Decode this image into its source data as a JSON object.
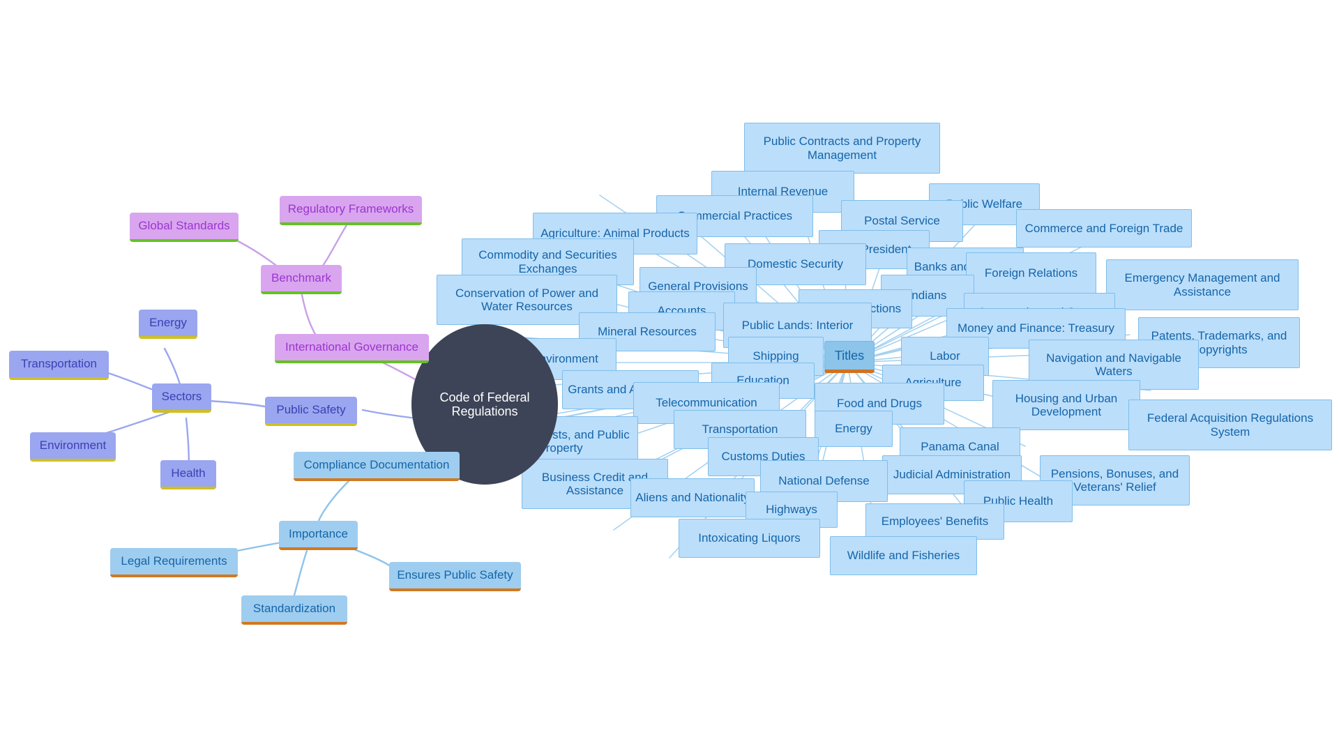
{
  "diagram": {
    "type": "mind-map",
    "root": {
      "label": "Code of Federal Regulations",
      "shape": "ellipse",
      "fill": "#3d4457",
      "text_color": "#ffffff"
    },
    "palette": {
      "title_fill": "#bbdefb",
      "title_stroke": "#7fbde9",
      "title_text": "#1565a8",
      "hub_fill": "#8cc4ea",
      "hub_underline": "#d2711e",
      "importance_fill": "#9ecdf0",
      "importance_underline": "#d2781f",
      "importance_text": "#1565a8",
      "sector_fill": "#9aa6ef",
      "sector_underline": "#cfc01f",
      "sector_text": "#3b3fb5",
      "governance_fill": "#d9a5ef",
      "governance_underline": "#63c224",
      "governance_text": "#9b35cf",
      "background": "#ffffff"
    },
    "branches": [
      {
        "name": "sectors",
        "hub": "Sectors",
        "children": [
          "Transportation",
          "Energy",
          "Environment",
          "Health"
        ]
      },
      {
        "name": "public-safety",
        "hub": "Public Safety",
        "children": []
      },
      {
        "name": "governance",
        "hub": "Benchmark",
        "children": [
          "Global Standards",
          "Regulatory Frameworks",
          "International Governance"
        ]
      },
      {
        "name": "importance",
        "hub": "Importance",
        "children": [
          "Legal Requirements",
          "Standardization",
          "Ensures Public Safety"
        ]
      },
      {
        "name": "compliance",
        "hub": "Compliance Documentation",
        "children": []
      },
      {
        "name": "titles",
        "hub": "Titles",
        "children": []
      }
    ],
    "nodes": {
      "root": "Code of Federal Regulations",
      "sectors": {
        "hub": "Sectors",
        "transportation": "Transportation",
        "energy": "Energy",
        "environment": "Environment",
        "health": "Health"
      },
      "public_safety": "Public Safety",
      "governance": {
        "benchmark": "Benchmark",
        "global_standards": "Global Standards",
        "regulatory_frameworks": "Regulatory Frameworks",
        "international_governance": "International Governance"
      },
      "importance": {
        "hub": "Importance",
        "legal_requirements": "Legal Requirements",
        "standardization": "Standardization",
        "ensures_public_safety": "Ensures Public Safety"
      },
      "compliance_documentation": "Compliance Documentation",
      "titles_hub": "Titles"
    },
    "titles": [
      "Public Contracts and Property Management",
      "Internal Revenue",
      "Public Welfare",
      "Commercial Practices",
      "Postal Service",
      "Commerce and Foreign Trade",
      "Agriculture: Animal Products",
      "The President",
      "Commodity and Securities Exchanges",
      "Domestic Security",
      "Banks and Banking",
      "Foreign Relations",
      "Emergency Management and Assistance",
      "Conservation of Power and Water Resources",
      "General Provisions",
      "Indians",
      "Accounts",
      "Federal Elections",
      "Aeronautics and Space",
      "Mineral Resources",
      "Public Lands: Interior",
      "Money and Finance: Treasury",
      "Patents, Trademarks, and Copyrights",
      "Protection of Environment",
      "Shipping",
      "Labor",
      "Navigation and Navigable Waters",
      "Education",
      "Agriculture",
      "Grants and Agreements",
      "Telecommunication",
      "Food and Drugs",
      "Housing and Urban Development",
      "Parks, Forests, and Public Property",
      "Transportation",
      "Energy",
      "Federal Acquisition Regulations System",
      "Panama Canal",
      "Business Credit and Assistance",
      "Customs Duties",
      "Judicial Administration",
      "Pensions, Bonuses, and Veterans' Relief",
      "Aliens and Nationality",
      "National Defense",
      "Public Health",
      "Highways",
      "Employees' Benefits",
      "Intoxicating Liquors",
      "Wildlife and Fisheries"
    ]
  }
}
